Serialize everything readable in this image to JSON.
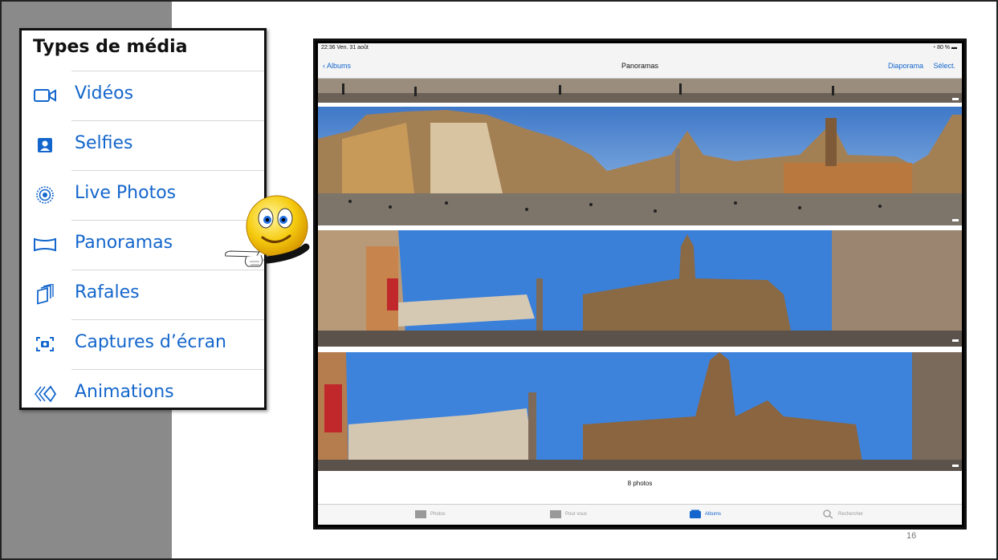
{
  "media_panel": {
    "title": "Types de média",
    "items": [
      {
        "label": "Vidéos",
        "icon": "video-icon"
      },
      {
        "label": "Selfies",
        "icon": "selfie-icon"
      },
      {
        "label": "Live Photos",
        "icon": "live-photos-icon"
      },
      {
        "label": "Panoramas",
        "icon": "panorama-icon"
      },
      {
        "label": "Rafales",
        "icon": "burst-icon"
      },
      {
        "label": "Captures d’écran",
        "icon": "screenshot-icon"
      },
      {
        "label": "Animations",
        "icon": "animation-icon"
      }
    ],
    "accent_color": "#1466cc"
  },
  "ipad": {
    "status": {
      "time": "22:36  Ven. 31 août",
      "battery": "80 %"
    },
    "nav": {
      "back": "Albums",
      "title": "Panoramas",
      "slideshow": "Diaporama",
      "select": "Sélect."
    },
    "photo_count": "8 photos",
    "tabs": [
      {
        "label": "Photos",
        "icon": "photos-tab-icon",
        "active": false
      },
      {
        "label": "Pour vous",
        "icon": "for-you-tab-icon",
        "active": false
      },
      {
        "label": "Albums",
        "icon": "albums-tab-icon",
        "active": true
      },
      {
        "label": "Rechercher",
        "icon": "search-tab-icon",
        "active": false
      }
    ]
  },
  "page_number": "16"
}
